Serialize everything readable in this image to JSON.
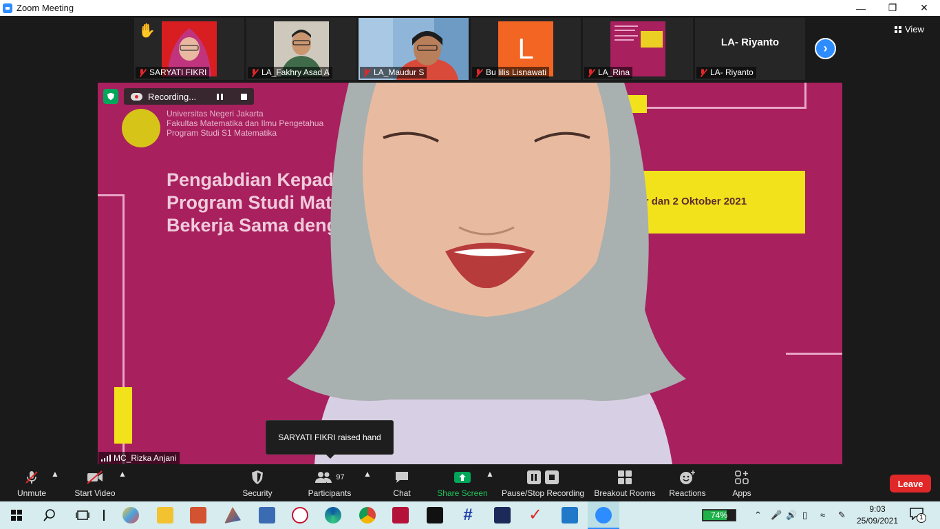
{
  "window": {
    "title": "Zoom Meeting"
  },
  "gallery": {
    "view_label": "View",
    "participants": [
      {
        "name": "SARYATI FIKRI",
        "raised_hand": true
      },
      {
        "name": "LA_Fakhry Asad A"
      },
      {
        "name": "LA_Maudur S"
      },
      {
        "name": "Bu lilis Lisnawati",
        "avatar_letter": "L"
      },
      {
        "name": "LA_Rina"
      },
      {
        "name": "LA- Riyanto",
        "display_name": "LA- Riyanto"
      }
    ]
  },
  "main_video": {
    "speaker": "MC_Rizka Anjani",
    "recording_label": "Recording...",
    "slide": {
      "university": "Universitas Negeri Jakarta",
      "faculty": "Fakultas Matematika dan Ilmu Pengetahua",
      "program": "Program Studi S1 Matematika",
      "line1": "Pengabdian Kepad",
      "line2": "Program Studi Mate",
      "line3": "Bekerja Sama denga",
      "date": "eptember dan 2 Oktober 2021"
    }
  },
  "notification": {
    "text": "SARYATI FIKRI raised hand"
  },
  "toolbar": {
    "unmute": "Unmute",
    "start_video": "Start Video",
    "security": "Security",
    "participants": "Participants",
    "participant_count": "97",
    "chat": "Chat",
    "share_screen": "Share Screen",
    "pause_stop_recording": "Pause/Stop Recording",
    "breakout_rooms": "Breakout Rooms",
    "reactions": "Reactions",
    "apps": "Apps",
    "leave": "Leave"
  },
  "taskbar": {
    "battery_percent": "74%",
    "battery_level": 0.74,
    "time": "9:03",
    "date": "25/09/2021",
    "notifications_count": "1"
  },
  "colors": {
    "zoom_blue": "#2d8cff",
    "leave_red": "#e02828",
    "share_green": "#00a65a",
    "slide_magenta": "#a8205e",
    "slide_yellow": "#f2e21c"
  }
}
